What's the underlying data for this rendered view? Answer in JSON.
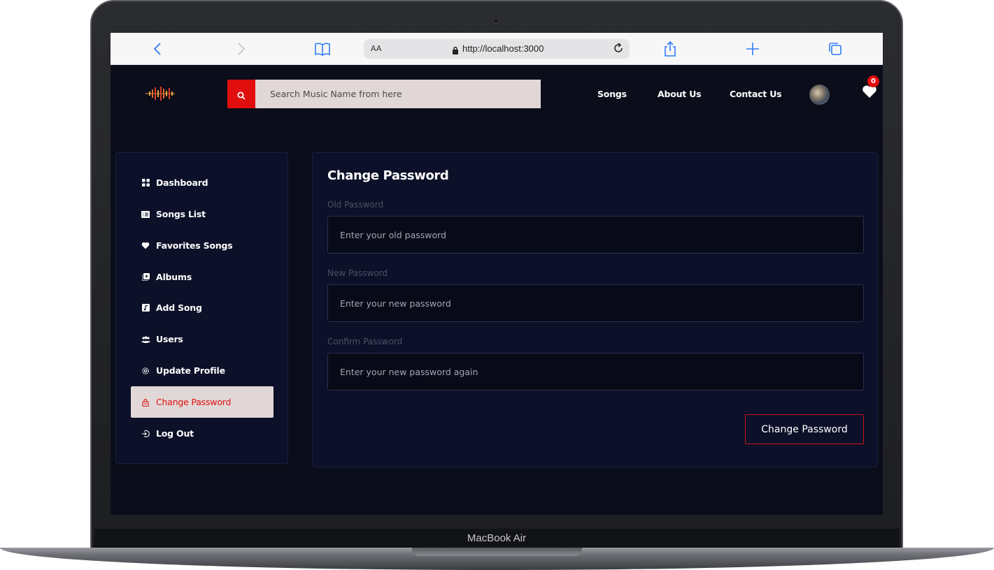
{
  "device": {
    "label": "MacBook Air"
  },
  "browser": {
    "text_size_label": "AA",
    "url": "http://localhost:3000"
  },
  "header": {
    "search_placeholder": "Search Music Name from here",
    "nav": [
      "Songs",
      "About Us",
      "Contact Us"
    ],
    "favorites_count": "0"
  },
  "sidebar": {
    "items": [
      {
        "label": "Dashboard",
        "icon": "grid-icon"
      },
      {
        "label": "Songs List",
        "icon": "list-icon"
      },
      {
        "label": "Favorites Songs",
        "icon": "heart-icon"
      },
      {
        "label": "Albums",
        "icon": "album-icon"
      },
      {
        "label": "Add Song",
        "icon": "music-note-icon"
      },
      {
        "label": "Users",
        "icon": "users-icon"
      },
      {
        "label": "Update Profile",
        "icon": "gear-icon"
      },
      {
        "label": "Change Password",
        "icon": "lock-icon",
        "active": true
      },
      {
        "label": "Log Out",
        "icon": "logout-icon"
      }
    ]
  },
  "form": {
    "title": "Change Password",
    "fields": [
      {
        "label": "Old Password",
        "placeholder": "Enter your old password"
      },
      {
        "label": "New Password",
        "placeholder": "Enter your new password"
      },
      {
        "label": "Confirm Password",
        "placeholder": "Enter your new password again"
      }
    ],
    "submit_label": "Change Password"
  },
  "colors": {
    "accent": "#e10e0e",
    "background": "#0b0d1a",
    "panel": "#0c1028",
    "active_item_bg": "#e1d7d7"
  }
}
